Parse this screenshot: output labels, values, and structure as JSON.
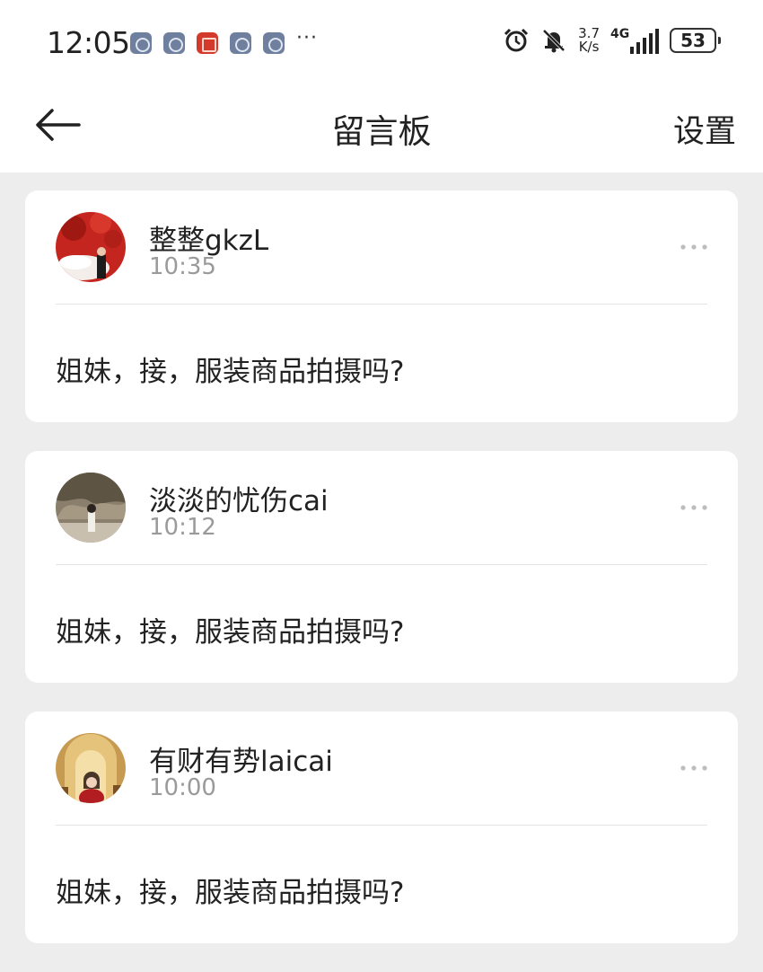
{
  "status_bar": {
    "time": "12:05",
    "more_notifications": "···",
    "net_speed_value": "3.7",
    "net_speed_unit": "K/s",
    "network_type": "4G",
    "battery_level": "53"
  },
  "header": {
    "title": "留言板",
    "settings_label": "设置"
  },
  "messages": [
    {
      "user_name": "整整gkzL",
      "time": "10:35",
      "text": "姐妹，接，服装商品拍摄吗?"
    },
    {
      "user_name": "淡淡的忧伤cai",
      "time": "10:12",
      "text": "姐妹，接，服装商品拍摄吗?"
    },
    {
      "user_name": "有财有势laicai",
      "time": "10:00",
      "text": "姐妹，接，服装商品拍摄吗?"
    }
  ]
}
